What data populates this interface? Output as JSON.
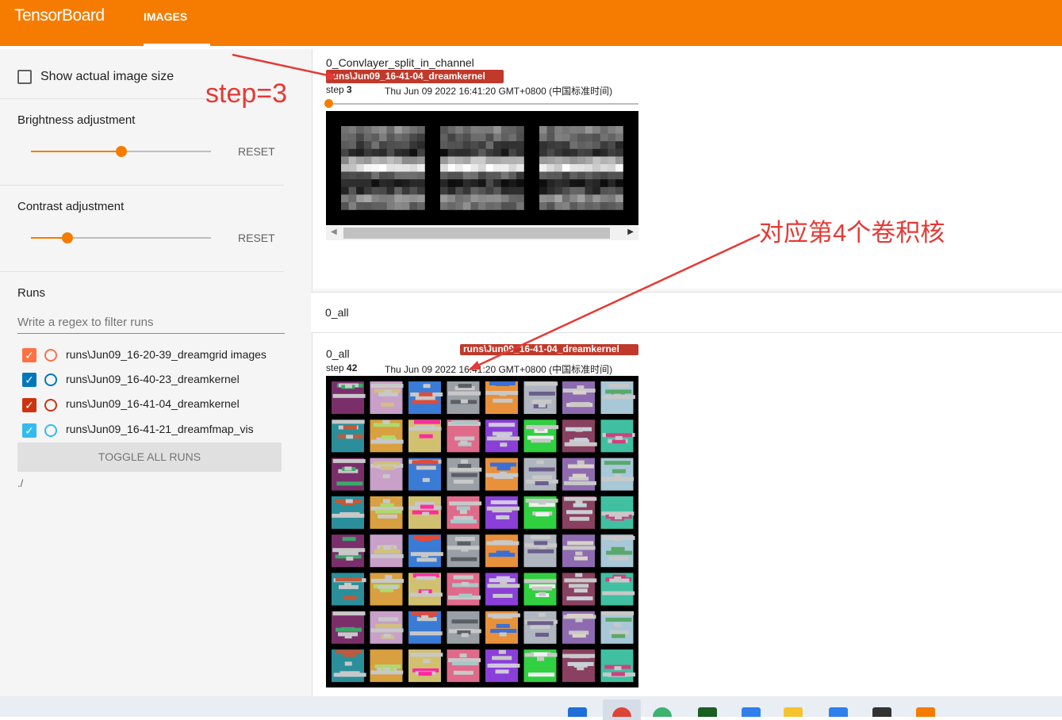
{
  "app": {
    "title": "TensorBoard",
    "tab": "IMAGES"
  },
  "sidebar": {
    "show_actual_size": "Show actual image size",
    "brightness": {
      "label": "Brightness adjustment",
      "reset": "RESET",
      "value": 0.5
    },
    "contrast": {
      "label": "Contrast adjustment",
      "reset": "RESET",
      "value": 0.2
    },
    "runs_title": "Runs",
    "filter_placeholder": "Write a regex to filter runs",
    "runs": [
      {
        "name": "runs\\Jun09_16-20-39_dreamgrid images",
        "color": "#ff7043",
        "checked": true
      },
      {
        "name": "runs\\Jun09_16-40-23_dreamkernel",
        "color": "#0077bb",
        "checked": true
      },
      {
        "name": "runs\\Jun09_16-41-04_dreamkernel",
        "color": "#cc3311",
        "checked": true
      },
      {
        "name": "runs\\Jun09_16-41-21_dreamfmap_vis",
        "color": "#33bbee",
        "checked": true
      }
    ],
    "toggle_all": "TOGGLE ALL RUNS",
    "log_dir": "./"
  },
  "cards": [
    {
      "title": "0_Convlayer_split_in_channel",
      "run": "runs\\Jun09_16-41-04_dreamkernel",
      "step_label": "step",
      "step": "3",
      "time": "Thu Jun 09 2022 16:41:20 GMT+0800 (中国标准时间)"
    },
    {
      "title": "0_all",
      "run": "runs\\Jun09_16-41-04_dreamkernel",
      "step_label": "step",
      "step": "42",
      "time": "Thu Jun 09 2022 16:41:20 GMT+0800 (中国标准时间)"
    }
  ],
  "section_title": "0_all",
  "annotations": {
    "step_note": "step=3",
    "kernel_note": "对应第4个卷积核"
  },
  "colors": {
    "accent": "#f57c00",
    "annotation": "#e53935"
  }
}
